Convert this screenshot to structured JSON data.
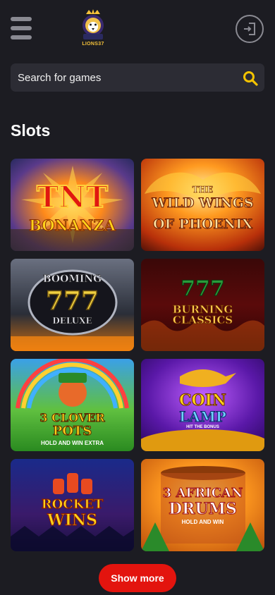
{
  "header": {
    "logo_text": "LIONS37",
    "menu_icon": "hamburger-menu-icon",
    "login_icon": "login-door-icon"
  },
  "search": {
    "placeholder": "Search for games",
    "icon": "search-icon"
  },
  "slots": {
    "title": "Slots",
    "games": [
      {
        "line1": "TNT",
        "line2": "BONANZA",
        "line3": ""
      },
      {
        "line1": "THE",
        "line2": "WILD WINGS",
        "line3": "OF PHOENIX"
      },
      {
        "line1": "BOOMING",
        "line2": "777",
        "line3": "DELUXE"
      },
      {
        "line1": "777",
        "line2": "BURNING CLASSICS",
        "line3": ""
      },
      {
        "line1": "3 CLOVER",
        "line2": "POTS",
        "line3": "HOLD AND WIN EXTRA"
      },
      {
        "line1": "COIN",
        "line2": "LAMP",
        "line3": "HIT THE BONUS"
      },
      {
        "line1": "ROCKET",
        "line2": "WINS",
        "line3": ""
      },
      {
        "line1": "3 AFRICAN",
        "line2": "DRUMS",
        "line3": "HOLD AND WIN"
      }
    ],
    "show_more_label": "Show more"
  },
  "colors": {
    "background": "#1c1c22",
    "search_bg": "#2c2c34",
    "accent_yellow": "#f5c400",
    "show_more_red": "#e3140e"
  }
}
